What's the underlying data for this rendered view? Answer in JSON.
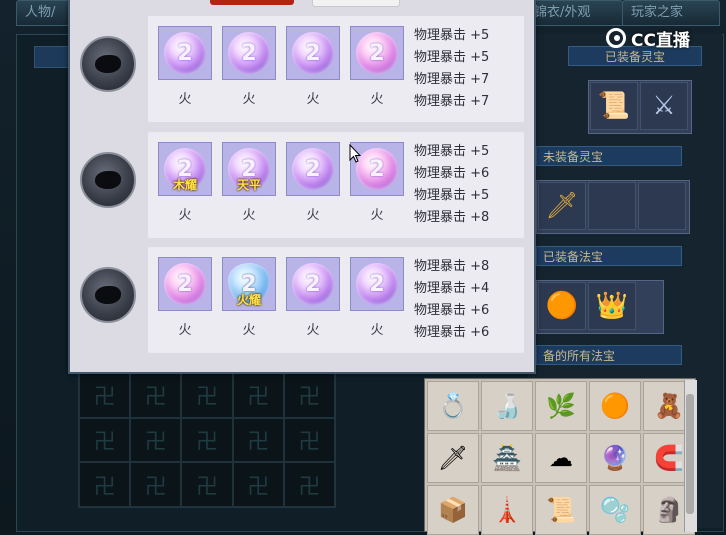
{
  "background": {
    "tabs": [
      "人物/",
      "锦衣/外观",
      "玩家之家"
    ],
    "equipped_lingbao_header": "已装备灵宝",
    "section_equip_lingbao": "未装备灵宝",
    "section_equip_fabao": "已装备法宝",
    "section_all_fabao": "备的所有法宝"
  },
  "watermark": {
    "text": "CC直播"
  },
  "popup": {
    "rows": [
      {
        "gems": [
          {
            "element": "火",
            "label": "",
            "style": "purple"
          },
          {
            "element": "火",
            "label": "",
            "style": "purple"
          },
          {
            "element": "火",
            "label": "",
            "style": "purple"
          },
          {
            "element": "火",
            "label": "",
            "style": "pink"
          }
        ],
        "stats": [
          "物理暴击 +5",
          "物理暴击 +5",
          "物理暴击 +7",
          "物理暴击 +7"
        ]
      },
      {
        "gems": [
          {
            "element": "火",
            "label": "木耀",
            "style": "purple"
          },
          {
            "element": "火",
            "label": "天平",
            "style": "purple"
          },
          {
            "element": "火",
            "label": "",
            "style": "purple"
          },
          {
            "element": "火",
            "label": "",
            "style": "pink"
          }
        ],
        "stats": [
          "物理暴击 +5",
          "物理暴击 +6",
          "物理暴击 +5",
          "物理暴击 +8"
        ]
      },
      {
        "gems": [
          {
            "element": "火",
            "label": "",
            "style": "pink"
          },
          {
            "element": "火",
            "label": "火耀",
            "style": "blue"
          },
          {
            "element": "火",
            "label": "",
            "style": "purple"
          },
          {
            "element": "火",
            "label": "",
            "style": "purple"
          }
        ],
        "stats": [
          "物理暴击 +8",
          "物理暴击 +4",
          "物理暴击 +6",
          "物理暴击 +6"
        ]
      }
    ]
  },
  "colors": {
    "accent_red": "#b32417",
    "gem_cell": "#b8b4e8",
    "gem_label": "#ffe14a"
  }
}
